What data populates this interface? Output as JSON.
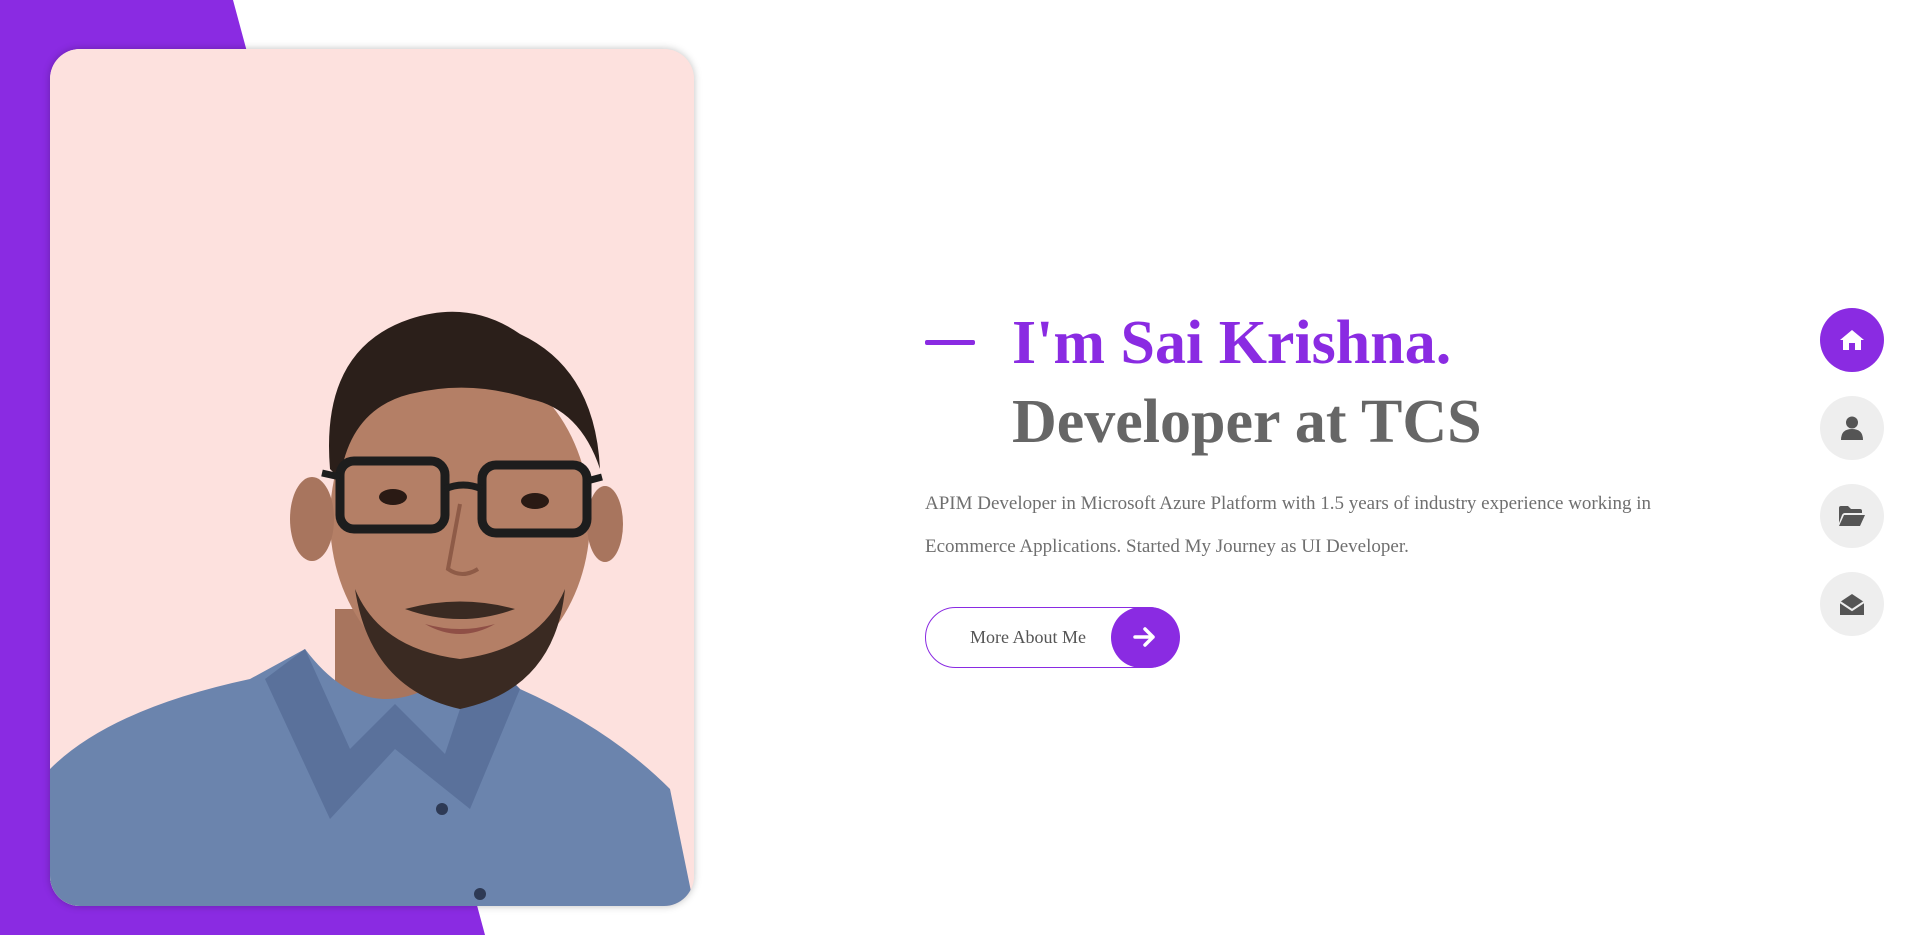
{
  "hero": {
    "name": "I'm Sai Krishna.",
    "role": "Developer at TCS",
    "description": "APIM Developer in Microsoft Azure Platform with 1.5 years of industry experience working in Ecommerce Applications. Started My Journey as UI Developer.",
    "button_label": "More About Me"
  },
  "nav": {
    "items": [
      {
        "icon": "home-icon",
        "active": true
      },
      {
        "icon": "user-icon",
        "active": false
      },
      {
        "icon": "folder-open-icon",
        "active": false
      },
      {
        "icon": "envelope-open-icon",
        "active": false
      }
    ]
  },
  "colors": {
    "accent": "#8a2be2",
    "heading_gray": "#666666",
    "text_gray": "#6f6f6f",
    "photo_bg": "#fde1de",
    "nav_inactive": "#eeeeee"
  }
}
